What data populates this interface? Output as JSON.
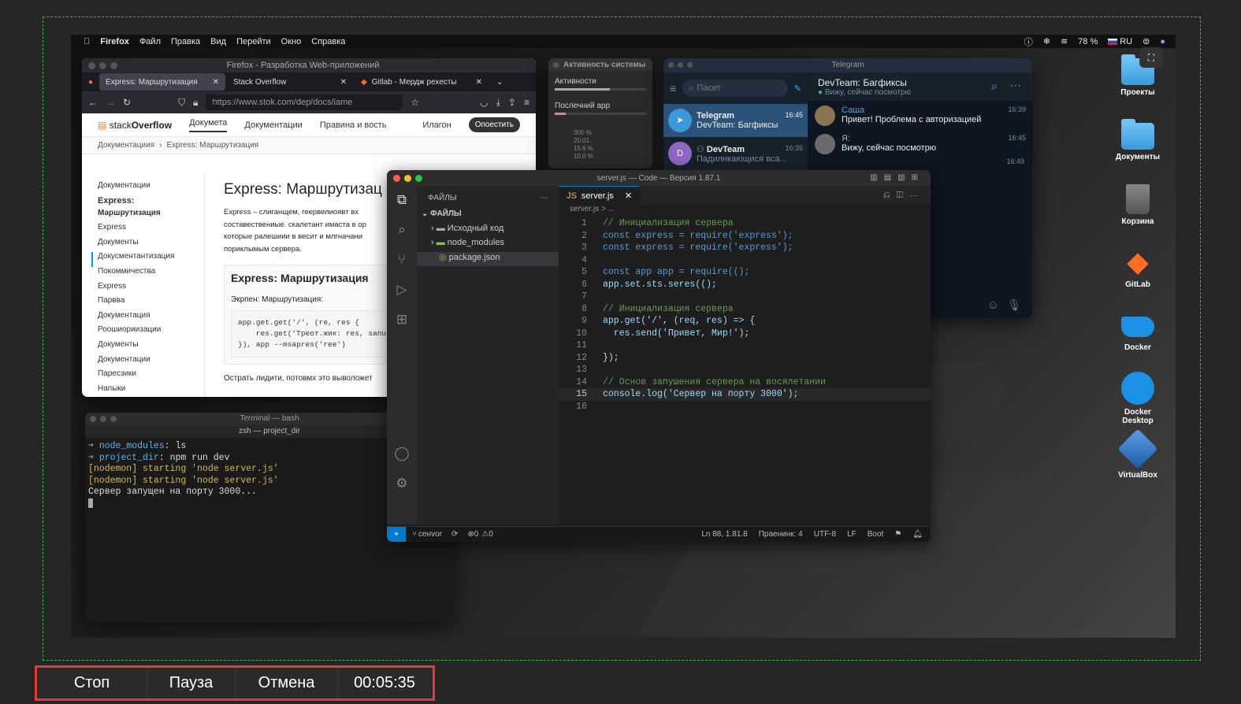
{
  "menubar": {
    "app": "Firefox",
    "items": [
      "Файл",
      "Правка",
      "Вид",
      "Перейти",
      "Окно",
      "Справка"
    ],
    "battery": "78 %",
    "lang": "RU"
  },
  "firefox": {
    "window_title": "Firefox - Разработка Web-приложений",
    "tabs": [
      "Express: Маршрутизация",
      "Stack Overflow",
      "Gitlab - Мердж рехесты"
    ],
    "url": "https://www.stok.com/dep/docs/iame",
    "site": {
      "logo_light": "stack",
      "logo_bold": "Overflow",
      "nav": [
        "Докумета",
        "Документации",
        "Правина и вость",
        "Илагон"
      ],
      "cta": "Опоестить",
      "breadcrumb": [
        "Документациия",
        "Express: Маршрутизация"
      ],
      "side_items": [
        "Документации",
        "Express:",
        "Маршрутизация",
        "Express",
        "Документы",
        "Докусментантизация",
        "Покоммичества",
        "Express",
        "Парвва",
        "Документация",
        "Роошиориизации",
        "Документы",
        "Документации",
        "Паресзики",
        "Напыки"
      ],
      "heading": "Express: Маршрутизац",
      "intro": "Express ‒ слиганщем, геервелиоявт вх составествениые. скалетант имаста в ор которые ралешиии в весит и млгначани пориклымым сервера.",
      "box_heading": "Express: Маршрутизация",
      "box_sub": "Экрпен: Маршрутизация:",
      "code": [
        "app.get.get('/', (re, res {",
        "    res.get('Треот.жик: res, sanuu",
        "}), app --msapres('ree')"
      ],
      "footer": "Острать лидити, потовмх это выволожет"
    }
  },
  "activity": {
    "title": "Активность системы",
    "item1": "Активности",
    "item2": "Послечний арр",
    "rows": [
      "300 %",
      "20.01.",
      "15.6 %",
      "10.0 %"
    ]
  },
  "telegram": {
    "window_title": "Telegram",
    "search_placeholder": "Пасет",
    "chats": [
      {
        "name": "Telegram",
        "preview": "DevTeam: Багфиксы",
        "time": "16:45"
      },
      {
        "name": "DevTeam",
        "preview": "Падилнкающися вса...",
        "time": "16:35",
        "initial": "D"
      }
    ],
    "header_title": "DevTeam: Багфиксы",
    "header_status": "Вижу, сейчас посмотрю",
    "messages": [
      {
        "author": "Саша",
        "text": "Привет! Проблема с авторизацией",
        "time": "16:39"
      },
      {
        "author": "Я:",
        "text": "Вижу, сейчас посмотрю",
        "time": "16:45"
      },
      {
        "author": "",
        "text": "",
        "time": "16:49"
      }
    ]
  },
  "vscode": {
    "window_title": "server.js — Code — Версия 1.87.1",
    "explorer_title": "ФАЙЛЫ",
    "section": "ФАЙЛЫ",
    "files": [
      "Исходный код",
      "node_modules",
      "package.json"
    ],
    "tab": "server.js",
    "breadcrumb": "server.js > ...",
    "code_lines": [
      {
        "n": "1",
        "t": "// Инициализация сервера"
      },
      {
        "n": "2",
        "t": "const express = require('express');"
      },
      {
        "n": "3",
        "t": "const express = require('express');"
      },
      {
        "n": "4",
        "t": ""
      },
      {
        "n": "5",
        "t": "const app app = require(();"
      },
      {
        "n": "6",
        "t": "app.set.sts.seres(();"
      },
      {
        "n": "7",
        "t": ""
      },
      {
        "n": "8",
        "t": "// Инициализация сервера"
      },
      {
        "n": "9",
        "t": "app.get('/', (req, res) => {"
      },
      {
        "n": "10",
        "t": "  res.send('Привет, Мир!');"
      },
      {
        "n": "11",
        "t": ""
      },
      {
        "n": "12",
        "t": "});"
      },
      {
        "n": "13",
        "t": ""
      },
      {
        "n": "14",
        "t": "// Основ запушения сервера на восялетании"
      },
      {
        "n": "15",
        "t": "console.log('Сервер на порту 3000');"
      },
      {
        "n": "16",
        "t": ""
      }
    ],
    "status": {
      "branch": "ceнvor",
      "errors": "0",
      "warnings": "0",
      "position": "Ln 88, 1.81.8",
      "indent": "Праенинк: 4",
      "encoding": "UTF-8",
      "eol": "LF",
      "lang": "Boot"
    }
  },
  "terminal": {
    "window_title": "Terminal — bash",
    "subtitle": "zsh — project_dir",
    "lines": [
      {
        "arrow": "➜",
        "dir": "node_modules",
        "cmd": ": ls"
      },
      {
        "arrow": "➜",
        "dir": "project_dir",
        "cmd": ": npm run dev"
      }
    ],
    "nodemon": [
      "[nodemon] starting 'node server.js'",
      "[nodemon] starting 'node server.js'"
    ],
    "output": "Сервер запущен на порту 3000..."
  },
  "dock": [
    "Проекты",
    "Документы",
    "Корзина",
    "GitLab",
    "Docker",
    "Docker Desktop",
    "VirtualBox"
  ],
  "controls": {
    "stop": "Стоп",
    "pause": "Пауза",
    "cancel": "Отмена",
    "timer": "00:05:35"
  },
  "colors": {
    "accent_red": "#e53935",
    "capture_border": "#3cba3c",
    "tg_blue": "#2b5278",
    "vscode_blue": "#007acc"
  }
}
